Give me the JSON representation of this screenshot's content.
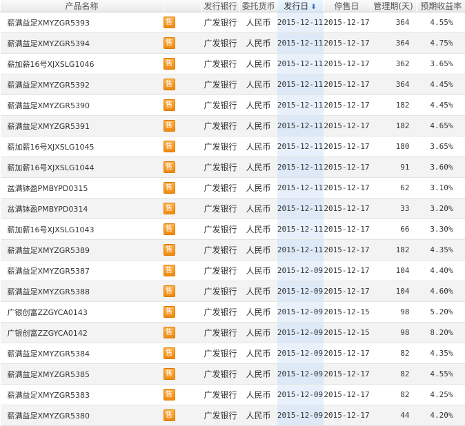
{
  "headers": {
    "name": "产品名称",
    "bank": "发行银行",
    "currency": "委托货币",
    "issue_date": "发行日",
    "stop_date": "停售日",
    "period": "管理期(天)",
    "yield": "预期收益率"
  },
  "sort_icon": "sort-down-arrow-icon",
  "badge_label": "售",
  "colors": {
    "badge": "#f5961a",
    "sorted_column": "#e8f1fb",
    "sort_arrow": "#2a68b8"
  },
  "rows": [
    {
      "name": "薪满益足XMYZGR5393",
      "bank": "广发银行",
      "currency": "人民币",
      "issue_date": "2015-12-11",
      "stop_date": "2015-12-17",
      "period": "364",
      "yield": "4.55%"
    },
    {
      "name": "薪满益足XMYZGR5394",
      "bank": "广发银行",
      "currency": "人民币",
      "issue_date": "2015-12-11",
      "stop_date": "2015-12-17",
      "period": "364",
      "yield": "4.75%"
    },
    {
      "name": "薪加薪16号XJXSLG1046",
      "bank": "广发银行",
      "currency": "人民币",
      "issue_date": "2015-12-11",
      "stop_date": "2015-12-17",
      "period": "362",
      "yield": "3.65%"
    },
    {
      "name": "薪满益足XMYZGR5392",
      "bank": "广发银行",
      "currency": "人民币",
      "issue_date": "2015-12-11",
      "stop_date": "2015-12-17",
      "period": "364",
      "yield": "4.45%"
    },
    {
      "name": "薪满益足XMYZGR5390",
      "bank": "广发银行",
      "currency": "人民币",
      "issue_date": "2015-12-11",
      "stop_date": "2015-12-17",
      "period": "182",
      "yield": "4.45%"
    },
    {
      "name": "薪满益足XMYZGR5391",
      "bank": "广发银行",
      "currency": "人民币",
      "issue_date": "2015-12-11",
      "stop_date": "2015-12-17",
      "period": "182",
      "yield": "4.65%"
    },
    {
      "name": "薪加薪16号XJXSLG1045",
      "bank": "广发银行",
      "currency": "人民币",
      "issue_date": "2015-12-11",
      "stop_date": "2015-12-17",
      "period": "180",
      "yield": "3.65%"
    },
    {
      "name": "薪加薪16号XJXSLG1044",
      "bank": "广发银行",
      "currency": "人民币",
      "issue_date": "2015-12-11",
      "stop_date": "2015-12-17",
      "period": "91",
      "yield": "3.60%"
    },
    {
      "name": "盆满钵盈PMBYPD0315",
      "bank": "广发银行",
      "currency": "人民币",
      "issue_date": "2015-12-11",
      "stop_date": "2015-12-17",
      "period": "62",
      "yield": "3.10%"
    },
    {
      "name": "盆满钵盈PMBYPD0314",
      "bank": "广发银行",
      "currency": "人民币",
      "issue_date": "2015-12-11",
      "stop_date": "2015-12-17",
      "period": "33",
      "yield": "3.20%"
    },
    {
      "name": "薪加薪16号XJXSLG1043",
      "bank": "广发银行",
      "currency": "人民币",
      "issue_date": "2015-12-11",
      "stop_date": "2015-12-17",
      "period": "66",
      "yield": "3.30%"
    },
    {
      "name": "薪满益足XMYZGR5389",
      "bank": "广发银行",
      "currency": "人民币",
      "issue_date": "2015-12-11",
      "stop_date": "2015-12-17",
      "period": "182",
      "yield": "4.35%"
    },
    {
      "name": "薪满益足XMYZGR5387",
      "bank": "广发银行",
      "currency": "人民币",
      "issue_date": "2015-12-09",
      "stop_date": "2015-12-17",
      "period": "104",
      "yield": "4.40%"
    },
    {
      "name": "薪满益足XMYZGR5388",
      "bank": "广发银行",
      "currency": "人民币",
      "issue_date": "2015-12-09",
      "stop_date": "2015-12-17",
      "period": "104",
      "yield": "4.60%"
    },
    {
      "name": "广银创富ZZGYCA0143",
      "bank": "广发银行",
      "currency": "人民币",
      "issue_date": "2015-12-09",
      "stop_date": "2015-12-15",
      "period": "98",
      "yield": "5.20%"
    },
    {
      "name": "广银创富ZZGYCA0142",
      "bank": "广发银行",
      "currency": "人民币",
      "issue_date": "2015-12-09",
      "stop_date": "2015-12-15",
      "period": "98",
      "yield": "8.20%"
    },
    {
      "name": "薪满益足XMYZGR5384",
      "bank": "广发银行",
      "currency": "人民币",
      "issue_date": "2015-12-09",
      "stop_date": "2015-12-17",
      "period": "82",
      "yield": "4.35%"
    },
    {
      "name": "薪满益足XMYZGR5385",
      "bank": "广发银行",
      "currency": "人民币",
      "issue_date": "2015-12-09",
      "stop_date": "2015-12-17",
      "period": "82",
      "yield": "4.55%"
    },
    {
      "name": "薪满益足XMYZGR5383",
      "bank": "广发银行",
      "currency": "人民币",
      "issue_date": "2015-12-09",
      "stop_date": "2015-12-17",
      "period": "82",
      "yield": "4.25%"
    },
    {
      "name": "薪满益足XMYZGR5380",
      "bank": "广发银行",
      "currency": "人民币",
      "issue_date": "2015-12-09",
      "stop_date": "2015-12-17",
      "period": "44",
      "yield": "4.20%"
    }
  ]
}
